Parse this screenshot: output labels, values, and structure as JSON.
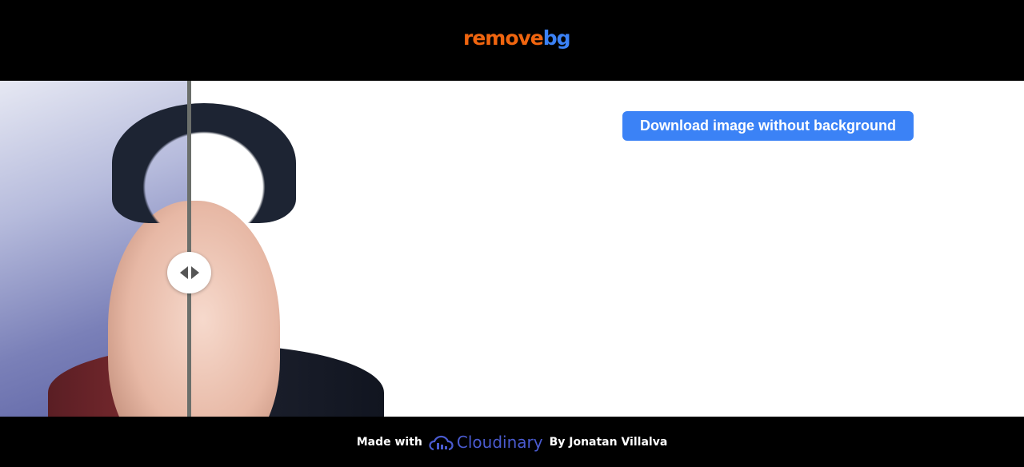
{
  "header": {
    "logo_part1": "remove",
    "logo_part2": "bg"
  },
  "compare": {
    "slider_position_percent": 49
  },
  "main": {
    "download_label": "Download image without background"
  },
  "footer": {
    "made_with": "Made with",
    "brand": "Cloudinary",
    "author": "By Jonatan Villalva"
  },
  "colors": {
    "accent": "#3b82f6",
    "logo_orange": "#f0650f",
    "cloudinary": "#4a5bd0"
  }
}
